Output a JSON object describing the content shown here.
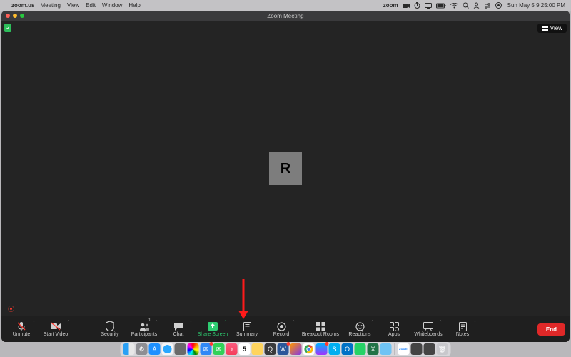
{
  "menubar": {
    "app": "zoom.us",
    "items": [
      "Meeting",
      "View",
      "Edit",
      "Window",
      "Help"
    ],
    "right": {
      "brand": "zoom",
      "clock": "Sun May 5  9:25:00 PM"
    }
  },
  "zoom": {
    "title": "Zoom Meeting",
    "view_label": "View",
    "avatar_initial": "R",
    "toolbar": {
      "unmute": "Unmute",
      "start_video": "Start Video",
      "security": "Security",
      "participants": "Participants",
      "participants_count": "1",
      "chat": "Chat",
      "share_screen": "Share Screen",
      "summary": "Summary",
      "record": "Record",
      "breakout": "Breakout Rooms",
      "reactions": "Reactions",
      "apps": "Apps",
      "whiteboards": "Whiteboards",
      "notes": "Notes",
      "end": "End"
    }
  },
  "dock": {
    "calendar_day": "5"
  }
}
